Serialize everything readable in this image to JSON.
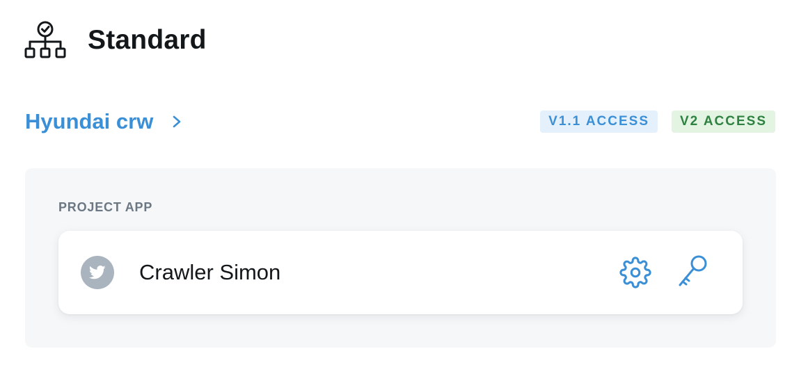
{
  "header": {
    "title": "Standard",
    "icon": "hierarchy-check-icon"
  },
  "project": {
    "name": "Hyundai crw",
    "chevron_icon": "chevron-right-icon",
    "badges": [
      {
        "label": "V1.1 ACCESS",
        "color": "#3a8fd6",
        "background": "#e4f0fb"
      },
      {
        "label": "V2 ACCESS",
        "color": "#2e8140",
        "background": "#e3f4e3"
      }
    ]
  },
  "section": {
    "label": "PROJECT APP"
  },
  "app": {
    "name": "Crawler Simon",
    "avatar_icon": "twitter-bird-icon",
    "actions": [
      {
        "icon": "gear-icon",
        "color": "#3a8fd6"
      },
      {
        "icon": "key-icon",
        "color": "#3a8fd6"
      }
    ]
  }
}
